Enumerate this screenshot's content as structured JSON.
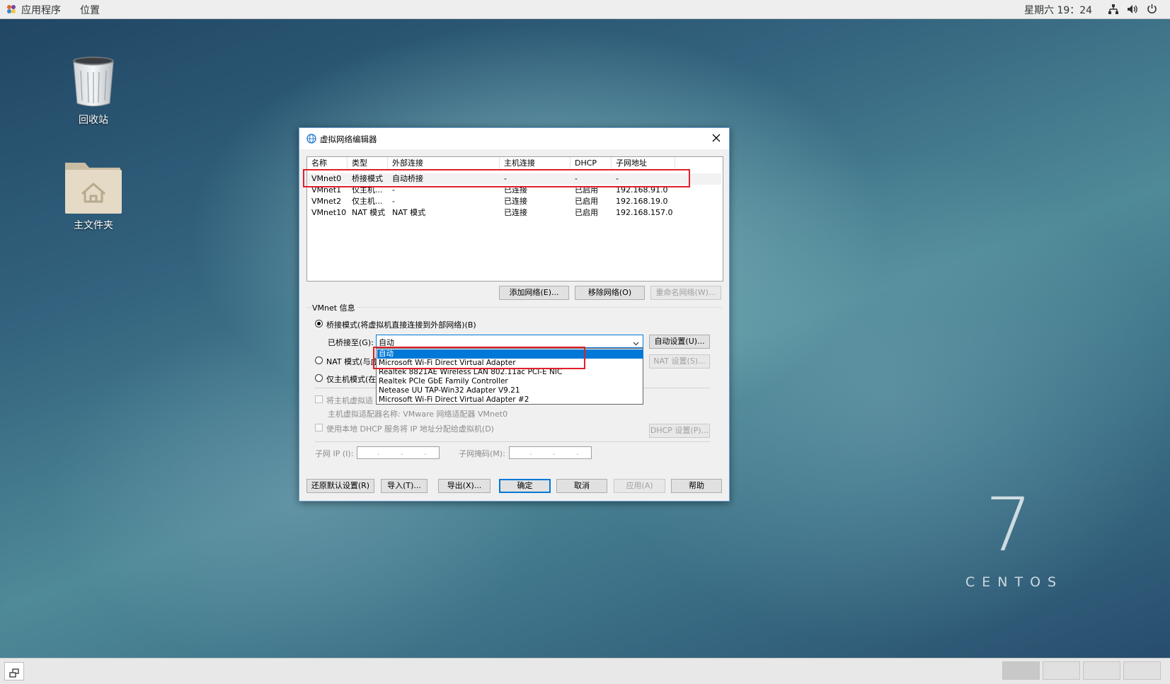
{
  "topbar": {
    "apps_label": "应用程序",
    "places_label": "位置",
    "clock": "星期六 19：24"
  },
  "desktop": {
    "trash_label": "回收站",
    "home_label": "主文件夹",
    "brand_number": "7",
    "brand_name": "CENTOS"
  },
  "dialog": {
    "title": "虚拟网络编辑器",
    "columns": [
      "名称",
      "类型",
      "外部连接",
      "主机连接",
      "DHCP",
      "子网地址"
    ],
    "rows": [
      {
        "name": "VMnet0",
        "type": "桥接模式",
        "external": "自动桥接",
        "host": "-",
        "dhcp": "-",
        "subnet": "-"
      },
      {
        "name": "VMnet1",
        "type": "仅主机...",
        "external": "-",
        "host": "已连接",
        "dhcp": "已启用",
        "subnet": "192.168.91.0"
      },
      {
        "name": "VMnet2",
        "type": "仅主机...",
        "external": "-",
        "host": "已连接",
        "dhcp": "已启用",
        "subnet": "192.168.19.0"
      },
      {
        "name": "VMnet10",
        "type": "NAT 模式",
        "external": "NAT 模式",
        "host": "已连接",
        "dhcp": "已启用",
        "subnet": "192.168.157.0"
      }
    ],
    "add_network": "添加网络(E)...",
    "remove_network": "移除网络(O)",
    "rename_network": "重命名网络(W)...",
    "vmnet_info": "VMnet 信息",
    "bridge_mode": "桥接模式(将虚拟机直接连接到外部网络)(B)",
    "bridged_to_label": "已桥接至(G):",
    "bridged_to_value": "自动",
    "auto_settings": "自动设置(U)...",
    "nat_mode": "NAT 模式(与虚",
    "nat_settings": "NAT 设置(S)...",
    "host_only_mode": "仅主机模式(在",
    "connect_host_adapter": "将主机虚拟适",
    "host_adapter_name": "主机虚拟适配器名称: VMware 网络适配器 VMnet0",
    "use_local_dhcp": "使用本地 DHCP 服务将 IP 地址分配给虚拟机(D)",
    "dhcp_settings": "DHCP 设置(P)...",
    "subnet_ip_label": "子网 IP (I):",
    "subnet_ip_value": ". . .",
    "subnet_mask_label": "子网掩码(M):",
    "subnet_mask_value": ". . .",
    "restore_defaults": "还原默认设置(R)",
    "import": "导入(T)...",
    "export": "导出(X)...",
    "ok": "确定",
    "cancel": "取消",
    "apply": "应用(A)",
    "help": "帮助",
    "dropdown_options": [
      "自动",
      "Microsoft Wi-Fi Direct Virtual Adapter",
      "Realtek 8821AE Wireless LAN 802.11ac PCI-E NIC",
      "Realtek PCIe GbE Family Controller",
      "Netease UU TAP-Win32 Adapter V9.21",
      "Microsoft Wi-Fi Direct Virtual Adapter #2"
    ]
  },
  "colors": {
    "selection": "#0078d7",
    "highlight_box": "#e0202a"
  }
}
